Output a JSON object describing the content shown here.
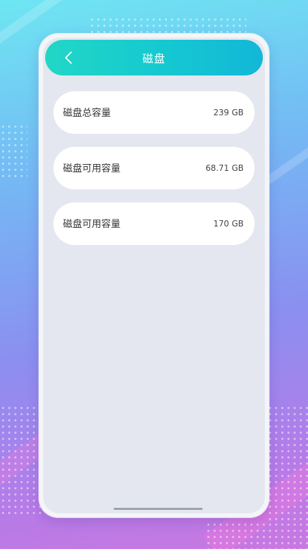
{
  "header": {
    "title": "磁盘",
    "back_icon": "chevron-left-icon"
  },
  "disk_info": [
    {
      "label": "磁盘总容量",
      "value": "239 GB"
    },
    {
      "label": "磁盘可用容量",
      "value": "68.71 GB"
    },
    {
      "label": "磁盘可用容量",
      "value": "170 GB"
    }
  ],
  "colors": {
    "header_gradient_start": "#22d7c6",
    "header_gradient_end": "#13b7d8",
    "screen_background": "#e4e7ef",
    "row_background": "#ffffff"
  }
}
